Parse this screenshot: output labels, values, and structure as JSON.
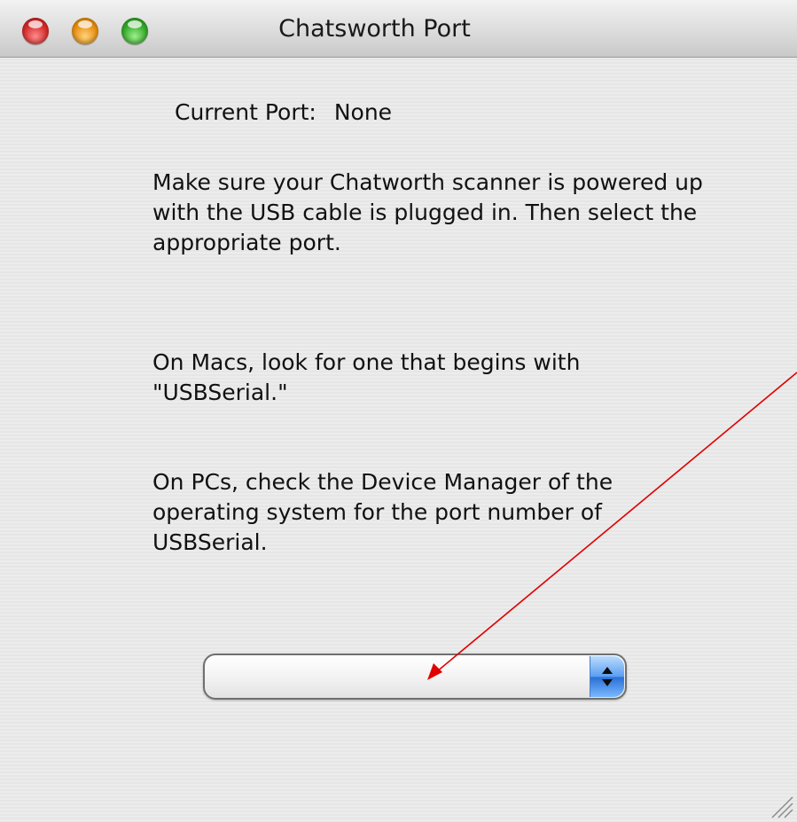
{
  "window": {
    "title": "Chatsworth Port"
  },
  "status": {
    "label": "Current Port:",
    "value": "None"
  },
  "instructions": {
    "paragraph_1": "Make sure your Chatworth scanner is powered up with the USB cable is plugged in. Then select the appropriate port.",
    "paragraph_2": "On Macs, look for one that begins with \"USBSerial.\"",
    "paragraph_3": "On PCs, check the Device Manager of the operating system for the port number of USBSerial."
  },
  "port_popup": {
    "selected_value": ""
  },
  "annotation": {
    "color": "#e00000"
  },
  "colors": {
    "close": "#d42a2a",
    "minimize": "#e68e10",
    "zoom": "#34a82a",
    "popup_accent": "#5a9ef0"
  }
}
